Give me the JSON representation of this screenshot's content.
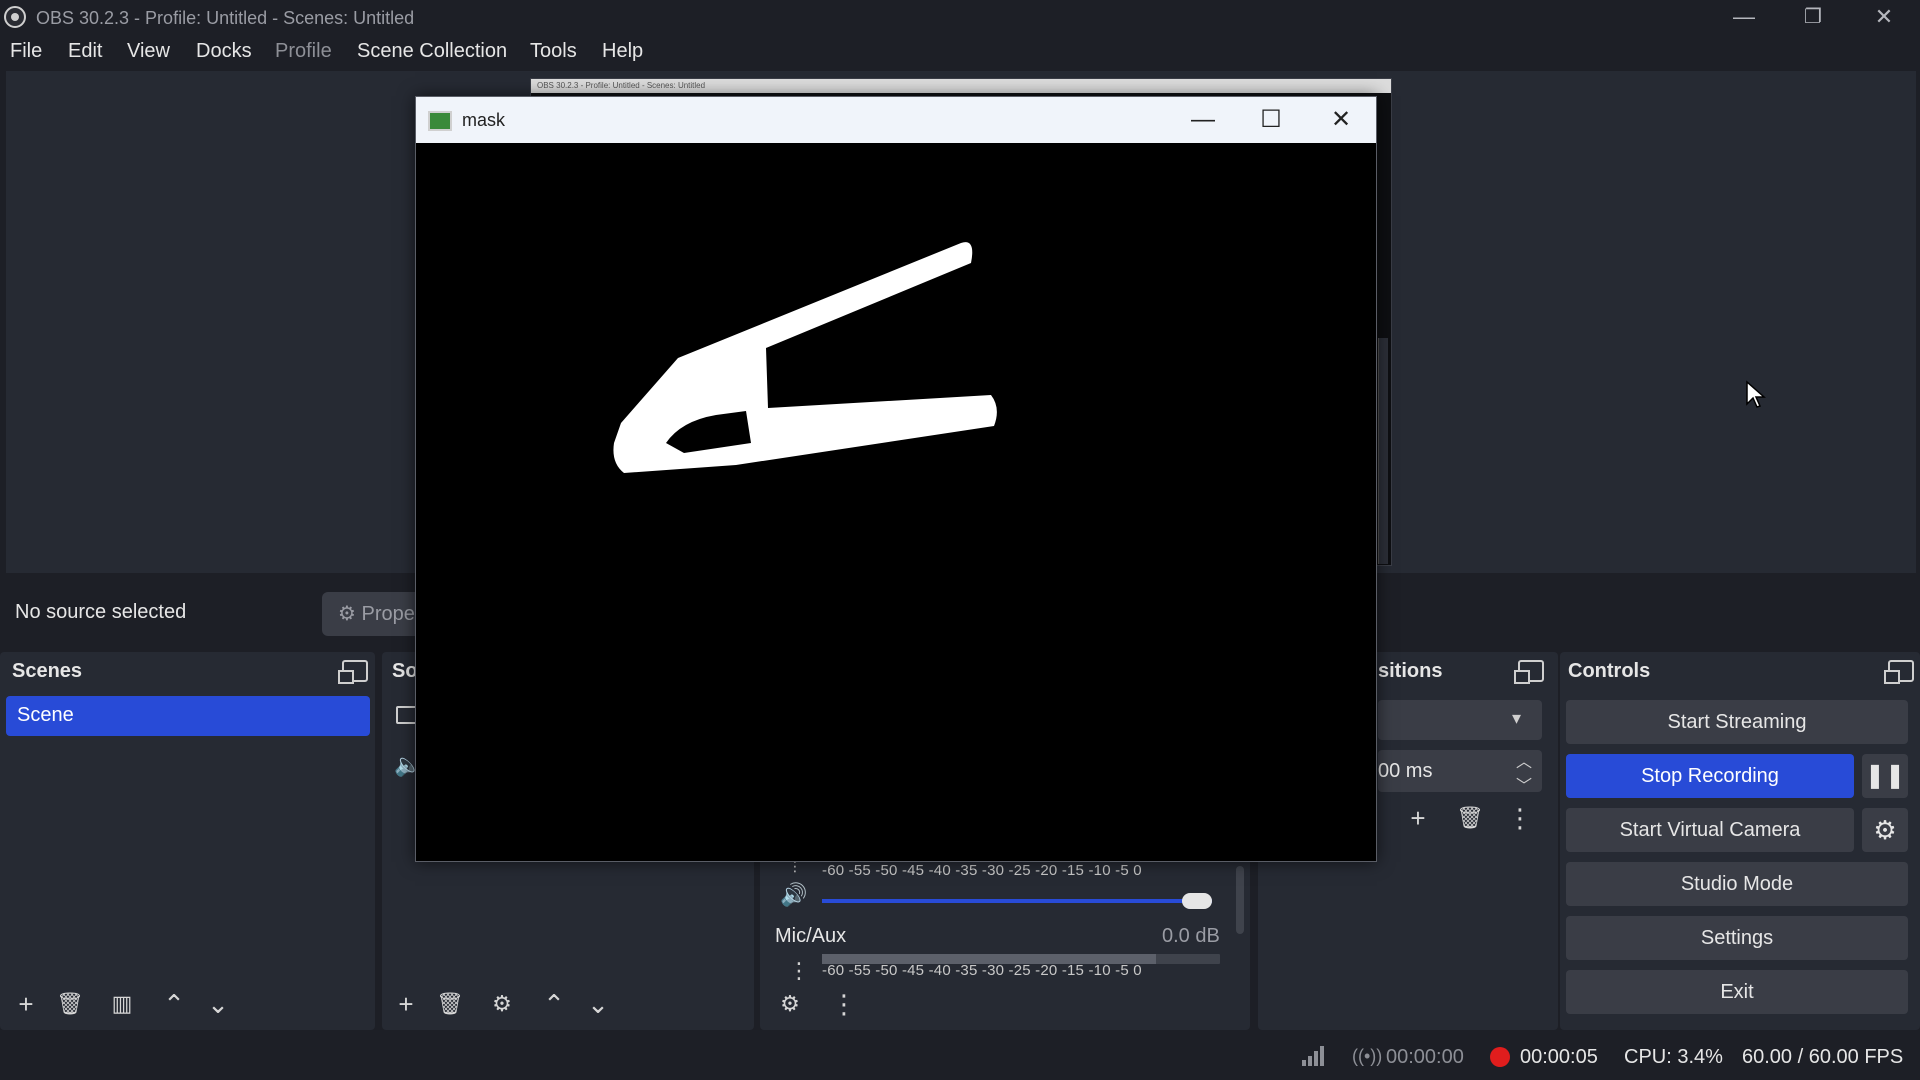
{
  "window": {
    "title": "OBS 30.2.3 - Profile: Untitled - Scenes: Untitled",
    "controls": [
      "minimize",
      "restore",
      "close"
    ]
  },
  "menu": [
    "File",
    "Edit",
    "View",
    "Docks",
    "Profile",
    "Scene Collection",
    "Tools",
    "Help"
  ],
  "preview_ghost": {
    "title": "OBS 30.2.3 - Profile: Untitled - Scenes: Untitled"
  },
  "source_bar": {
    "no_source": "No source selected",
    "properties_label": "Prope"
  },
  "scenes": {
    "title": "Scenes",
    "items": [
      "Scene"
    ]
  },
  "sources": {
    "title_partial": "So"
  },
  "mixer": {
    "scale": "-60 -55 -50 -45 -40 -35 -30 -25 -20 -15 -10 -5 0",
    "mic_label": "Mic/Aux",
    "mic_db": "0.0 dB",
    "desktop_volume": 1.0,
    "mic_level": 0.84
  },
  "transitions": {
    "title_partial": "sitions",
    "duration_partial": "00 ms"
  },
  "controls": {
    "title": "Controls",
    "start_streaming": "Start Streaming",
    "stop_recording": "Stop Recording",
    "start_virtual_camera": "Start Virtual Camera",
    "studio_mode": "Studio Mode",
    "settings": "Settings",
    "exit": "Exit"
  },
  "status": {
    "stream_time": "00:00:00",
    "rec_time": "00:00:05",
    "cpu": "CPU: 3.4%",
    "fps": "60.00 / 60.00 FPS"
  },
  "mask_window": {
    "title": "mask",
    "controls": [
      "minimize",
      "maximize",
      "close"
    ]
  },
  "colors": {
    "accent": "#284bd7",
    "record": "#e01d1d",
    "panel": "#262a33",
    "background": "#1d1f26"
  }
}
